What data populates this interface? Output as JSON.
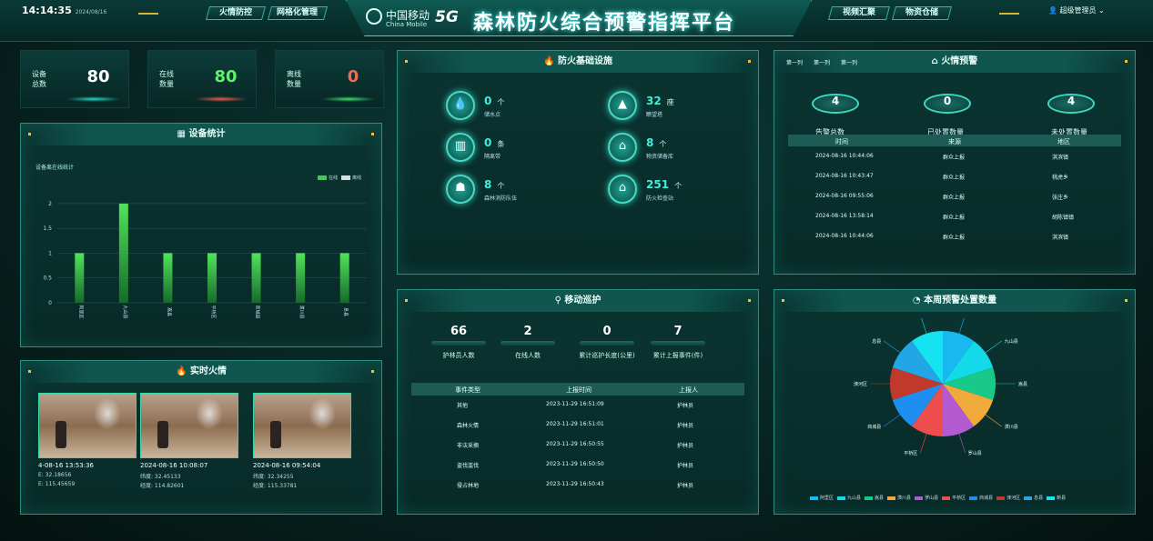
{
  "header": {
    "time": "14:14:35",
    "date": "2024/08/16",
    "nav_left": [
      "火情防控",
      "网格化管理"
    ],
    "nav_right": [
      "视频汇聚",
      "物资仓储"
    ],
    "brand_cn": "中国移动",
    "brand_en": "China Mobile",
    "fiveg": "5G",
    "title": "森林防火综合预警指挥平台",
    "user": "超级管理员"
  },
  "stats": [
    {
      "label": "设备\n总数",
      "value": "80",
      "color": "#ffffff",
      "glow": "#22d6c8"
    },
    {
      "label": "在线\n数量",
      "value": "80",
      "color": "#5df06a",
      "glow": "#e85a4f"
    },
    {
      "label": "离线\n数量",
      "value": "0",
      "color": "#f06a55",
      "glow": "#37e06a"
    }
  ],
  "device_panel": {
    "title": "设备统计",
    "subtitle": "设备离在线统计",
    "legend": [
      "在线",
      "离线"
    ]
  },
  "chart_data": {
    "type": "bar",
    "categories": [
      "阿里区",
      "九山县",
      "嵩县",
      "平桥区",
      "商城县",
      "潢川县",
      "息县"
    ],
    "series": [
      {
        "name": "在线",
        "values": [
          1,
          2,
          1,
          1,
          1,
          1,
          1
        ]
      },
      {
        "name": "离线",
        "values": [
          0,
          0,
          0,
          0,
          0,
          0,
          0
        ]
      }
    ],
    "yticks": [
      "0",
      "0.5",
      "1",
      "1.5",
      "2"
    ],
    "ylim": [
      0,
      2.2
    ]
  },
  "infra": {
    "title": "防火基础设施",
    "items": [
      {
        "value": "0",
        "unit": "个",
        "label": "储水点",
        "icon": "water-drop-icon",
        "glyph": "💧"
      },
      {
        "value": "32",
        "unit": "座",
        "label": "瞭望塔",
        "icon": "tower-icon",
        "glyph": "▲"
      },
      {
        "value": "0",
        "unit": "条",
        "label": "隔离带",
        "icon": "barrier-icon",
        "glyph": "▥"
      },
      {
        "value": "8",
        "unit": "个",
        "label": "物资储备库",
        "icon": "warehouse-icon",
        "glyph": "⌂"
      },
      {
        "value": "8",
        "unit": "个",
        "label": "森林消防队伍",
        "icon": "firefighter-icon",
        "glyph": "☗"
      },
      {
        "value": "251",
        "unit": "个",
        "label": "防火检查站",
        "icon": "checkpoint-icon",
        "glyph": "⌂"
      }
    ]
  },
  "warning": {
    "title": "火情预警",
    "tabs": [
      "第一列",
      "第一列",
      "第一列"
    ],
    "summary": [
      {
        "value": "4",
        "label": "告警总数"
      },
      {
        "value": "0",
        "label": "已处置数量"
      },
      {
        "value": "4",
        "label": "未处置数量"
      }
    ],
    "columns": [
      "时间",
      "来源",
      "地区"
    ],
    "rows": [
      [
        "2024-08-16 10:44:06",
        "群众上报",
        "淇滨镇"
      ],
      [
        "2024-08-16 10:43:47",
        "群众上报",
        "桃虎乡"
      ],
      [
        "2024-08-16 09:55:06",
        "群众上报",
        "张庄乡"
      ],
      [
        "2024-08-16 13:58:14",
        "群众上报",
        "胡陈镇镇"
      ],
      [
        "2024-08-16 10:44:06",
        "群众上报",
        "淇滨镇"
      ]
    ]
  },
  "patrol": {
    "title": "移动巡护",
    "stats": [
      {
        "value": "66",
        "label": "护林员人数"
      },
      {
        "value": "2",
        "label": "在线人数"
      },
      {
        "value": "0",
        "label": "累计巡护长度(公里)"
      },
      {
        "value": "7",
        "label": "累计上报事件(件)"
      }
    ],
    "columns": [
      "事件类型",
      "上报时间",
      "上报人"
    ],
    "rows": [
      [
        "其他",
        "2023-11-29 16:51:09",
        "护林员"
      ],
      [
        "森林火情",
        "2023-11-29 16:51:01",
        "护林员"
      ],
      [
        "非法采摘",
        "2023-11-29 16:50:55",
        "护林员"
      ],
      [
        "盗伐滥伐",
        "2023-11-29 16:50:50",
        "护林员"
      ],
      [
        "侵占林地",
        "2023-11-29 16:50:43",
        "护林员"
      ]
    ]
  },
  "fire": {
    "title": "实时火情",
    "items": [
      {
        "time": "4-08-16 13:53:36",
        "lat": "E: 32.18656",
        "lng": "E: 115.45659"
      },
      {
        "time": "2024-08-16 10:08:07",
        "lat": "纬度: 32.45133",
        "lng": "经度: 114.82601"
      },
      {
        "time": "2024-08-16 09:54:04",
        "lat": "纬度: 32.34255",
        "lng": "经度: 115.33781"
      }
    ]
  },
  "pie": {
    "title": "本周预警处置数量",
    "slices": [
      {
        "name": "阿里区",
        "value": 1,
        "color": "#18b8f0"
      },
      {
        "name": "九山县",
        "value": 1,
        "color": "#14d9e8"
      },
      {
        "name": "嵩县",
        "value": 1,
        "color": "#18c98a"
      },
      {
        "name": "潢川县",
        "value": 1,
        "color": "#f0a93b"
      },
      {
        "name": "罗山县",
        "value": 1,
        "color": "#b35ad0"
      },
      {
        "name": "平桥区",
        "value": 1,
        "color": "#ee4d4d"
      },
      {
        "name": "商城县",
        "value": 1,
        "color": "#1e8ff0"
      },
      {
        "name": "浉河区",
        "value": 1,
        "color": "#c0392b"
      },
      {
        "name": "息县",
        "value": 1,
        "color": "#22a6e6"
      },
      {
        "name": "新县",
        "value": 1,
        "color": "#15e3f0"
      }
    ]
  }
}
